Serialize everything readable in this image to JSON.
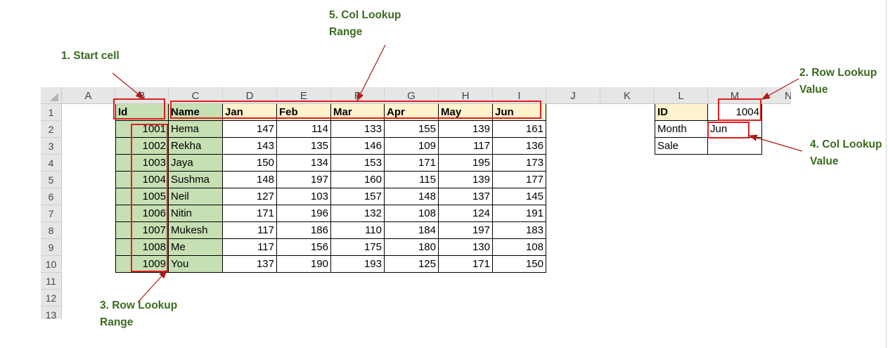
{
  "sheet": {
    "columns": [
      "A",
      "B",
      "C",
      "D",
      "E",
      "F",
      "G",
      "H",
      "I",
      "J",
      "K",
      "L",
      "M",
      "N"
    ],
    "rows": [
      "1",
      "2",
      "3",
      "4",
      "5",
      "6",
      "7",
      "8",
      "9",
      "10",
      "11",
      "12",
      "13"
    ],
    "header": [
      "Id",
      "Name",
      "Jan",
      "Feb",
      "Mar",
      "Apr",
      "May",
      "Jun"
    ],
    "data": [
      [
        "1001",
        "Hema",
        "147",
        "114",
        "133",
        "155",
        "139",
        "161"
      ],
      [
        "1002",
        "Rekha",
        "143",
        "135",
        "146",
        "109",
        "117",
        "136"
      ],
      [
        "1003",
        "Jaya",
        "150",
        "134",
        "153",
        "171",
        "195",
        "173"
      ],
      [
        "1004",
        "Sushma",
        "148",
        "197",
        "160",
        "115",
        "139",
        "177"
      ],
      [
        "1005",
        "Neil",
        "127",
        "103",
        "157",
        "148",
        "137",
        "145"
      ],
      [
        "1006",
        "Nitin",
        "171",
        "196",
        "132",
        "108",
        "124",
        "191"
      ],
      [
        "1007",
        "Mukesh",
        "117",
        "186",
        "110",
        "184",
        "197",
        "183"
      ],
      [
        "1008",
        "Me",
        "117",
        "156",
        "175",
        "180",
        "130",
        "108"
      ],
      [
        "1009",
        "You",
        "137",
        "190",
        "193",
        "125",
        "171",
        "150"
      ]
    ],
    "lookup": {
      "id_label": "ID",
      "id_value": "1004",
      "month_label": "Month",
      "month_value": "Jun",
      "sale_label": "Sale",
      "sale_value": ""
    }
  },
  "annotations": {
    "start_cell": "1. Start cell",
    "row_lookup_value_1": "2. Row Lookup",
    "row_lookup_value_2": "Value",
    "row_lookup_range_1": "3. Row Lookup",
    "row_lookup_range_2": "Range",
    "col_lookup_value_1": "4. Col Lookup",
    "col_lookup_value_2": "Value",
    "col_lookup_range_1": "5. Col Lookup",
    "col_lookup_range_2": "Range"
  },
  "colors": {
    "green_fill": "#c6e0b4",
    "header_fill": "#fff2cc",
    "highlight_box": "#e02020",
    "annotation_text": "#3a6b1f"
  }
}
